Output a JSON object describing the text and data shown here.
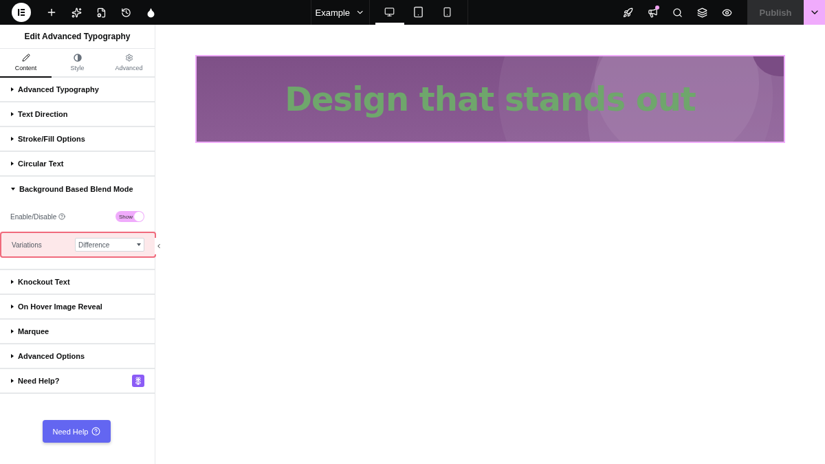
{
  "topbar": {
    "document": "Example",
    "devices": [
      {
        "kind": "desktop",
        "selected": true
      },
      {
        "kind": "tablet",
        "selected": false
      },
      {
        "kind": "mobile",
        "selected": false
      }
    ],
    "notification": true,
    "publish": "Publish"
  },
  "panel": {
    "title": "Edit Advanced Typography",
    "tabs": [
      {
        "kind": "content",
        "label": "Content",
        "selected": true
      },
      {
        "kind": "style",
        "label": "Style",
        "selected": false
      },
      {
        "kind": "advanced",
        "label": "Advanced",
        "selected": false
      }
    ],
    "sections": [
      {
        "title": "Advanced Typography",
        "expanded": false
      },
      {
        "title": "Text Direction",
        "expanded": false
      },
      {
        "title": "Stroke/Fill Options",
        "expanded": false
      },
      {
        "title": "Circular Text",
        "expanded": false
      },
      {
        "title": "Background Based Blend Mode",
        "expanded": true,
        "controls": [
          {
            "kind": "toggle",
            "label": "Enable/Disable",
            "on": true,
            "state_text": "Show"
          },
          {
            "kind": "select",
            "label": "Variations",
            "value": "Difference",
            "highlighted": true
          }
        ]
      },
      {
        "title": "Knockout Text",
        "expanded": false
      },
      {
        "title": "On Hover Image Reveal",
        "expanded": false
      },
      {
        "title": "Marquee",
        "expanded": false
      },
      {
        "title": "Advanced Options",
        "expanded": false
      },
      {
        "title": "Need Help?",
        "expanded": false,
        "badge": true
      }
    ],
    "help_button": "Need Help"
  },
  "canvas": {
    "heading": "Design that stands out",
    "selected": true
  }
}
